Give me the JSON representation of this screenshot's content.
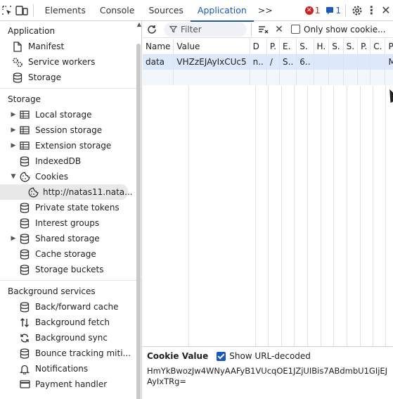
{
  "topbar": {
    "tabs": [
      {
        "label": "Elements"
      },
      {
        "label": "Console"
      },
      {
        "label": "Sources"
      },
      {
        "label": "Application"
      }
    ],
    "more_tabs": ">>",
    "errors_count": "1",
    "messages_count": "1"
  },
  "sidebar": {
    "application": {
      "title": "Application",
      "items": [
        {
          "label": "Manifest",
          "icon": "file-icon"
        },
        {
          "label": "Service workers",
          "icon": "gears-icon"
        },
        {
          "label": "Storage",
          "icon": "database-icon"
        }
      ]
    },
    "storage": {
      "title": "Storage",
      "items": [
        {
          "label": "Local storage",
          "icon": "table-icon",
          "expandable": true
        },
        {
          "label": "Session storage",
          "icon": "table-icon",
          "expandable": true
        },
        {
          "label": "Extension storage",
          "icon": "table-icon",
          "expandable": true
        },
        {
          "label": "IndexedDB",
          "icon": "database-icon"
        },
        {
          "label": "Cookies",
          "icon": "cookie-icon",
          "expanded": true
        },
        {
          "label": "http://natas11.nata...",
          "icon": "cookie-icon",
          "selected": true
        },
        {
          "label": "Private state tokens",
          "icon": "database-icon"
        },
        {
          "label": "Interest groups",
          "icon": "database-icon"
        },
        {
          "label": "Shared storage",
          "icon": "database-icon",
          "expandable": true
        },
        {
          "label": "Cache storage",
          "icon": "database-icon"
        },
        {
          "label": "Storage buckets",
          "icon": "database-icon"
        }
      ]
    },
    "background": {
      "title": "Background services",
      "items": [
        {
          "label": "Back/forward cache",
          "icon": "database-icon"
        },
        {
          "label": "Background fetch",
          "icon": "fetch-icon"
        },
        {
          "label": "Background sync",
          "icon": "sync-icon"
        },
        {
          "label": "Bounce tracking miti...",
          "icon": "database-icon"
        },
        {
          "label": "Notifications",
          "icon": "bell-icon"
        },
        {
          "label": "Payment handler",
          "icon": "card-icon"
        }
      ]
    }
  },
  "cookies_toolbar": {
    "filter_placeholder": "Filter",
    "only_show_label": "Only show cookie..."
  },
  "cookies_table": {
    "headers": [
      "Name",
      "Value",
      "D",
      "P.",
      "E.",
      "S.",
      "H.",
      "S.",
      "S.",
      "P.",
      "C.",
      "P."
    ],
    "rows": [
      [
        "data",
        "VHZzEJAyIxCUc5",
        "n..",
        "/",
        "S..",
        "6..",
        "",
        "",
        "",
        "",
        "",
        "M."
      ]
    ]
  },
  "cookie_value": {
    "title": "Cookie Value",
    "url_decoded_label": "Show URL-decoded",
    "url_decoded_checked": true,
    "value": "HmYkBwozJw4WNyAAFyB1VUcqOE1JZjUIBis7ABdmbU1GIjEJAyIxTRg="
  }
}
